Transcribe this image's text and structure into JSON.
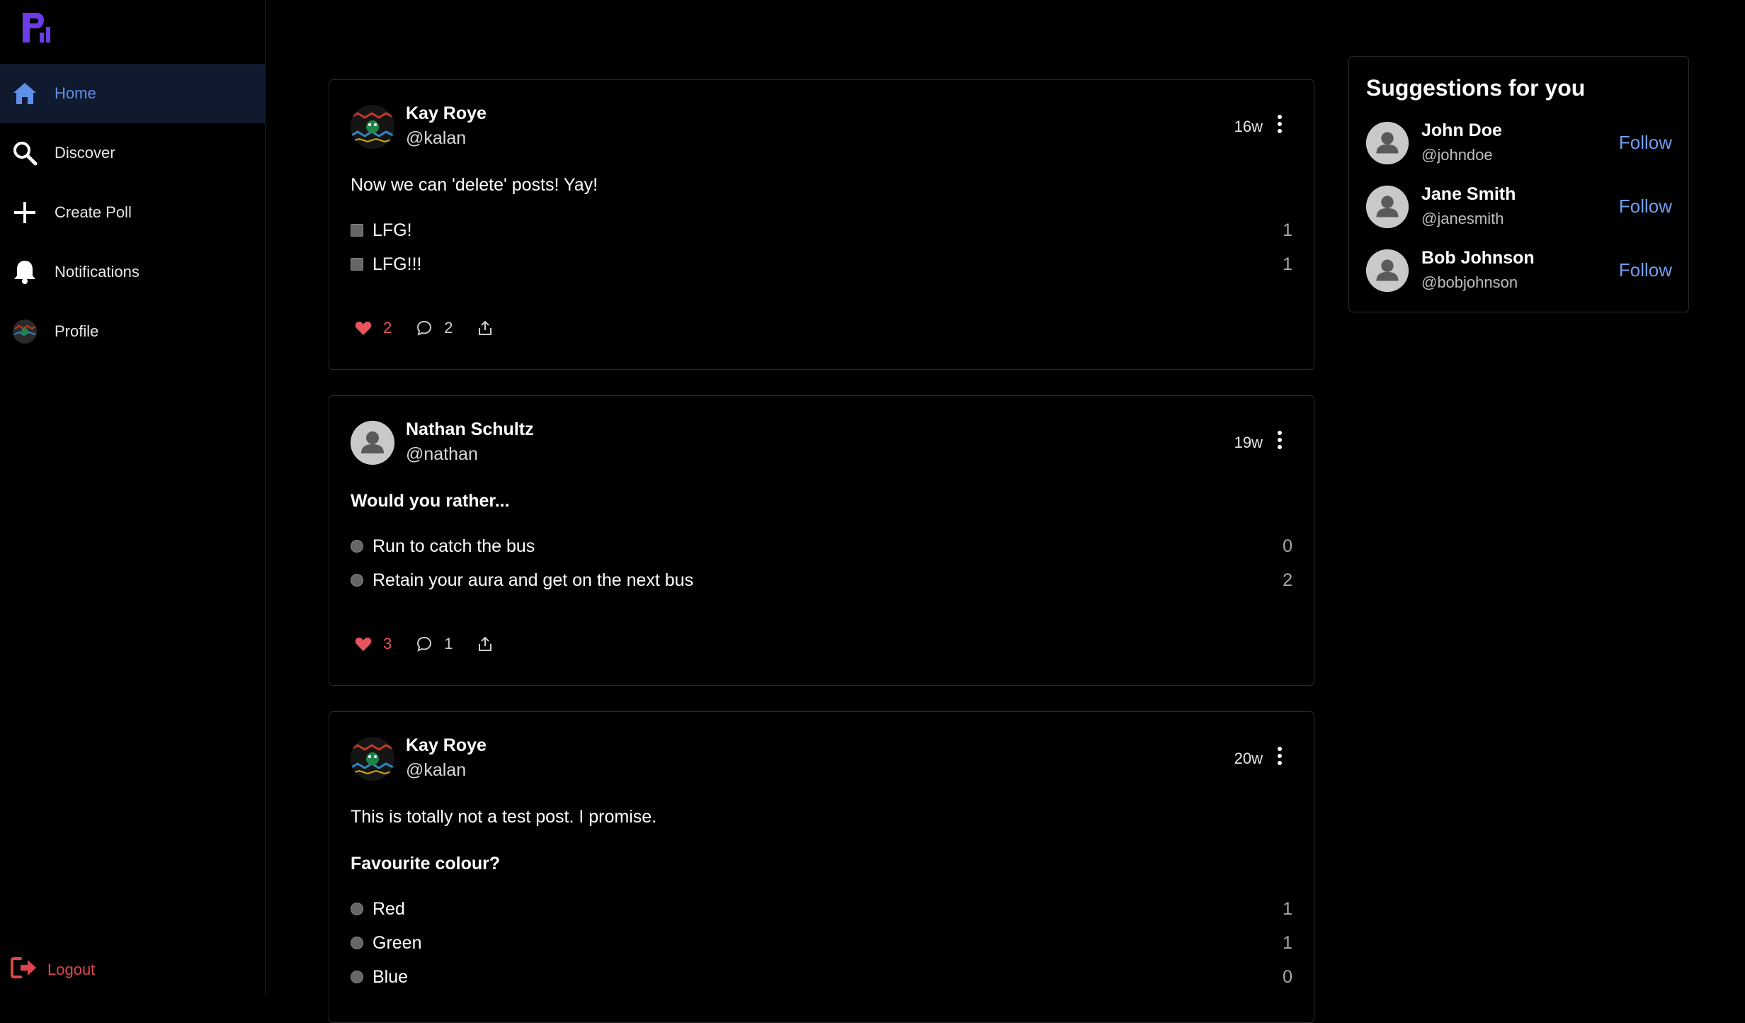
{
  "sidebar": {
    "items": [
      {
        "label": "Home",
        "icon": "home-icon",
        "active": true
      },
      {
        "label": "Discover",
        "icon": "search-icon",
        "active": false
      },
      {
        "label": "Create Poll",
        "icon": "plus-icon",
        "active": false
      },
      {
        "label": "Notifications",
        "icon": "bell-icon",
        "active": false
      },
      {
        "label": "Profile",
        "icon": "profile-avatar",
        "active": false
      }
    ],
    "logout_label": "Logout"
  },
  "posts": [
    {
      "name": "Kay Roye",
      "handle": "@kalan",
      "time": "16w",
      "text": "Now we can 'delete' posts! Yay!",
      "options": [
        {
          "label": "LFG!",
          "count": "1"
        },
        {
          "label": "LFG!!!",
          "count": "1"
        }
      ],
      "likes": "2",
      "comments": "2"
    },
    {
      "name": "Nathan Schultz",
      "handle": "@nathan",
      "time": "19w",
      "question": "Would you rather...",
      "options": [
        {
          "label": "Run to catch the bus",
          "count": "0"
        },
        {
          "label": "Retain your aura and get on the next bus",
          "count": "2"
        }
      ],
      "likes": "3",
      "comments": "1"
    },
    {
      "name": "Kay Roye",
      "handle": "@kalan",
      "time": "20w",
      "text": "This is totally not a test post. I promise.",
      "question": "Favourite colour?",
      "options": [
        {
          "label": "Red",
          "count": "1"
        },
        {
          "label": "Green",
          "count": "1"
        },
        {
          "label": "Blue",
          "count": "0"
        }
      ]
    }
  ],
  "suggestions": {
    "title": "Suggestions for you",
    "users": [
      {
        "name": "John Doe",
        "handle": "@johndoe",
        "action": "Follow"
      },
      {
        "name": "Jane Smith",
        "handle": "@janesmith",
        "action": "Follow"
      },
      {
        "name": "Bob Johnson",
        "handle": "@bobjohnson",
        "action": "Follow"
      }
    ]
  },
  "colors": {
    "accent": "#5f8fe8",
    "like": "#e8545c",
    "logout": "#e0454f",
    "logo": "#6a3de8"
  }
}
